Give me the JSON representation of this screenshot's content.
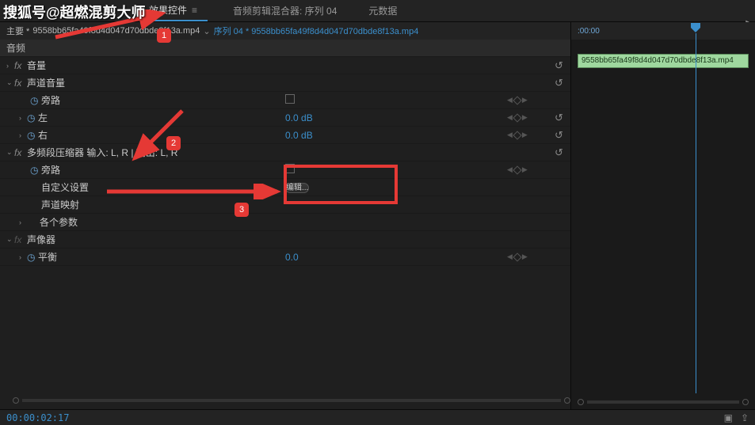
{
  "watermark": "搜狐号@超燃混剪大师",
  "tabs": {
    "effectControls": "效果控件",
    "audioMixer": "音频剪辑混合器: 序列 04",
    "metadata": "元数据"
  },
  "source": {
    "prefix": "主要 *",
    "clipName": "9558bb65fa49f8d4d047d70dbde8f13a.mp4",
    "linked": "序列 04 * 9558bb65fa49f8d4d047d70dbde8f13a.mp4"
  },
  "sections": {
    "audio": "音频",
    "volume": "音量",
    "channelVolume": "声道音量",
    "bypass": "旁路",
    "left": "左",
    "right": "右",
    "multiband": "多频段压缩器 输入: L, R | 输出: L, R",
    "customSetup": "自定义设置",
    "channelMap": "声道映射",
    "eachParam": "各个参数",
    "panner": "声像器",
    "balance": "平衡"
  },
  "values": {
    "leftDb": "0.0 dB",
    "rightDb": "0.0 dB",
    "balance": "0.0",
    "editBtn": "编辑..."
  },
  "timeline": {
    "start": ":00:00",
    "clipLabel": "9558bb65fa49f8d4d047d70dbde8f13a.mp4"
  },
  "status": {
    "timecode": "00:00:02:17"
  },
  "badges": {
    "b1": "1",
    "b2": "2",
    "b3": "3"
  }
}
